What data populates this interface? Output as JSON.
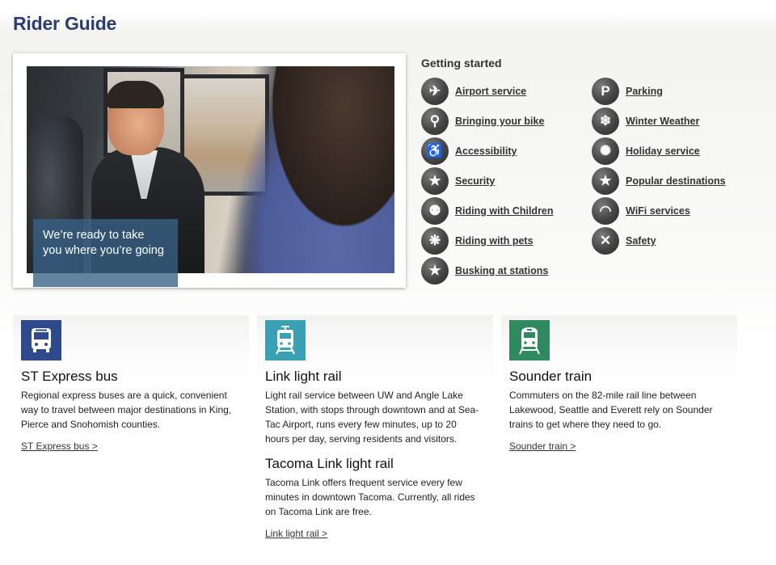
{
  "page": {
    "title": "Rider Guide"
  },
  "hero": {
    "caption_line1": "We’re ready to take",
    "caption_line2": "you where you’re going"
  },
  "getting_started": {
    "title": "Getting started",
    "left": [
      {
        "label": "Airport service",
        "icon": "airplane-icon",
        "glyph": "✈"
      },
      {
        "label": "Bringing your bike",
        "icon": "bicycle-icon",
        "glyph": "⚲"
      },
      {
        "label": "Accessibility",
        "icon": "wheelchair-icon",
        "glyph": "♿"
      },
      {
        "label": "Security",
        "icon": "shield-icon",
        "glyph": "★"
      },
      {
        "label": "Riding with Children",
        "icon": "family-icon",
        "glyph": "⚉"
      },
      {
        "label": "Riding with pets",
        "icon": "paw-icon",
        "glyph": "❋"
      },
      {
        "label": "Busking at stations",
        "icon": "star-icon",
        "glyph": "★"
      }
    ],
    "right": [
      {
        "label": "Parking",
        "icon": "parking-icon",
        "glyph": "P"
      },
      {
        "label": "Winter Weather",
        "icon": "snowflake-icon",
        "glyph": "❄"
      },
      {
        "label": "Holiday service",
        "icon": "burst-icon",
        "glyph": "✺"
      },
      {
        "label": "Popular destinations",
        "icon": "star-icon",
        "glyph": "★"
      },
      {
        "label": "WiFi services",
        "icon": "wifi-icon",
        "glyph": "◠"
      },
      {
        "label": "Safety",
        "icon": "safety-icon",
        "glyph": "✕"
      }
    ]
  },
  "cards": {
    "express": {
      "title": "ST Express bus",
      "desc": "Regional express buses are a quick, convenient way to travel between major destinations in King, Pierce and Snohomish counties.",
      "link": "ST Express bus >",
      "color": "#2e4a8c",
      "icon": "bus-icon"
    },
    "link": {
      "title": "Link light rail",
      "desc": "Light rail service between UW and Angle Lake Station, with stops through downtown and at Sea-Tac Airport, runs every few minutes, up to 20 hours per day, serving residents and visitors.",
      "sub_title": "Tacoma Link light rail",
      "sub_desc": "Tacoma Link offers frequent service every few minutes in downtown Tacoma. Currently, all rides on Tacoma Link are free.",
      "link": "Link light rail >",
      "color": "#3aa0b4",
      "icon": "light-rail-icon"
    },
    "sounder": {
      "title": "Sounder train",
      "desc": "Commuters on the 82-mile rail line between Lakewood, Seattle and Everett rely on Sounder trains to get where they need to go.",
      "link": "Sounder train >",
      "color": "#2f8a5f",
      "icon": "train-icon"
    }
  }
}
